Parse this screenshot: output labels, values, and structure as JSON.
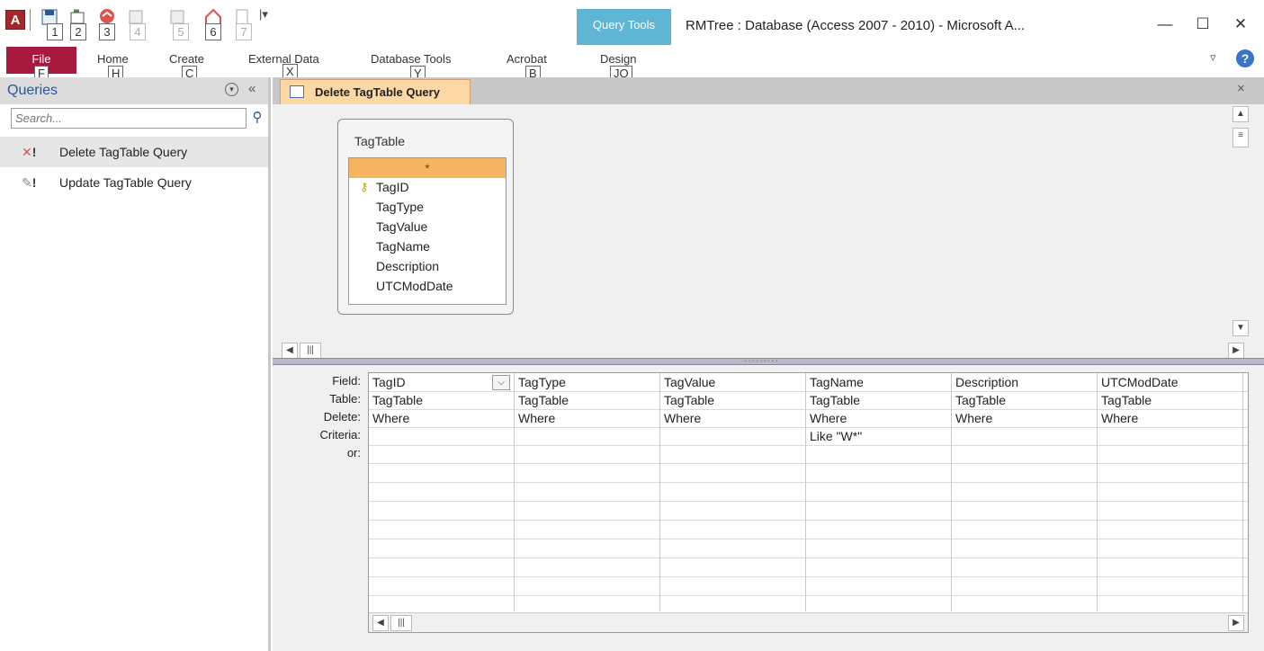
{
  "window": {
    "title": "RMTree : Database (Access 2007 - 2010)  -  Microsoft A...",
    "context_tab": "Query Tools",
    "controls": {
      "minimize": "—",
      "maximize": "☐",
      "close": "✕"
    }
  },
  "qat": {
    "app_letter": "A",
    "badges": [
      "1",
      "2",
      "3",
      "4",
      "5",
      "6",
      "7"
    ],
    "dropdown": "|▾"
  },
  "ribbon": {
    "file_label": "File",
    "tabs": [
      "Home",
      "Create",
      "External Data",
      "Database Tools",
      "Acrobat",
      "Design"
    ],
    "keytips": [
      "F",
      "H",
      "C",
      "X",
      "Y",
      "B",
      "JQ"
    ],
    "help": "?",
    "minimize": "▿"
  },
  "nav": {
    "title": "Queries",
    "menu_glyph": "▾",
    "collapse_glyph": "«",
    "search_placeholder": "Search...",
    "items": [
      {
        "label": "Delete TagTable Query",
        "icon": "delete-query-icon",
        "selected": true
      },
      {
        "label": "Update TagTable Query",
        "icon": "update-query-icon",
        "selected": false
      }
    ]
  },
  "document": {
    "tab_label": "Delete TagTable Query",
    "close": "×"
  },
  "field_list": {
    "table_name": "TagTable",
    "fields": [
      "*",
      "TagID",
      "TagType",
      "TagValue",
      "TagName",
      "Description",
      "UTCModDate"
    ]
  },
  "grid": {
    "row_labels": [
      "Field:",
      "Table:",
      "Delete:",
      "Criteria:",
      "or:"
    ],
    "columns": [
      {
        "field": "TagID",
        "table": "TagTable",
        "delete": "Where",
        "criteria": ""
      },
      {
        "field": "TagType",
        "table": "TagTable",
        "delete": "Where",
        "criteria": ""
      },
      {
        "field": "TagValue",
        "table": "TagTable",
        "delete": "Where",
        "criteria": ""
      },
      {
        "field": "TagName",
        "table": "TagTable",
        "delete": "Where",
        "criteria": "Like \"W*\""
      },
      {
        "field": "Description",
        "table": "TagTable",
        "delete": "Where",
        "criteria": ""
      },
      {
        "field": "UTCModDate",
        "table": "TagTable",
        "delete": "Where",
        "criteria": ""
      }
    ]
  },
  "colors": {
    "file_tab": "#a8193f",
    "context_tab": "#5fb6d4",
    "selected_doc_tab": "#fdd7a4",
    "field_list_highlight": "#f5b462"
  }
}
